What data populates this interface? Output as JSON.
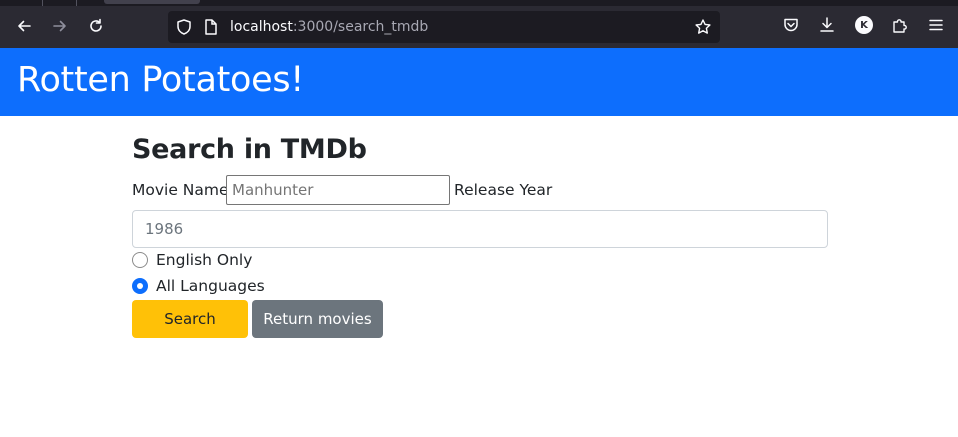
{
  "browser": {
    "url_host": "localhost",
    "url_path": ":3000/search_tmdb",
    "profile_initial": "K"
  },
  "navbar": {
    "brand": "Rotten Potatoes!"
  },
  "search_form": {
    "title": "Search in TMDb",
    "movie_name_label": "Movie Name",
    "movie_name_placeholder": "Manhunter",
    "release_year_label": "Release Year",
    "release_year_placeholder": "1986",
    "language_options": [
      {
        "label": "English Only",
        "checked": false
      },
      {
        "label": "All Languages",
        "checked": true
      }
    ],
    "search_button": "Search",
    "return_button": "Return movies"
  },
  "colors": {
    "navbar_bg": "#0d6efd",
    "search_button_bg": "#ffc107",
    "return_button_bg": "#6c757d",
    "radio_checked": "#0d6efd"
  }
}
